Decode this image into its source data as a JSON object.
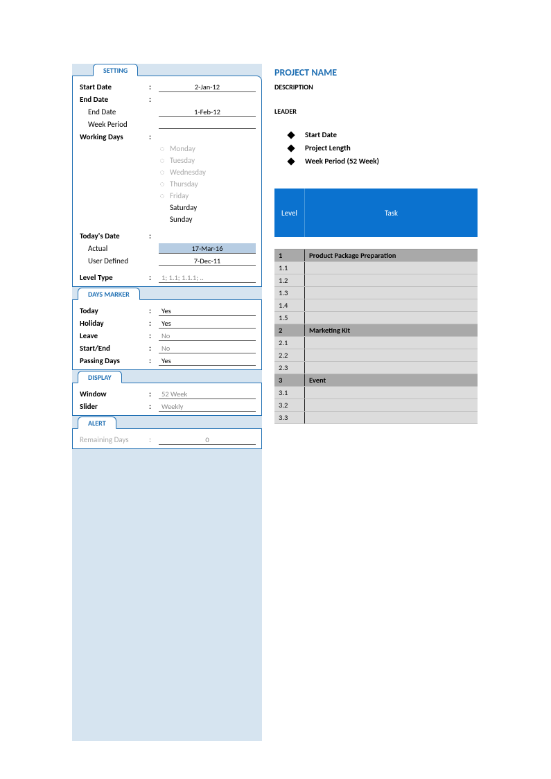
{
  "tabs": {
    "setting": "SETTING",
    "days_marker": "DAYS MARKER",
    "display": "DISPLAY",
    "alert": "ALERT"
  },
  "setting": {
    "start_date": {
      "label": "Start Date",
      "value": "2-Jan-12"
    },
    "end_date_label": "End Date",
    "end_date": {
      "label": "End Date",
      "value": "1-Feb-12"
    },
    "week_period": {
      "label": "Week Period",
      "value": ""
    },
    "working_days_label": "Working Days",
    "working_days": [
      {
        "name": "Monday",
        "active": false
      },
      {
        "name": "Tuesday",
        "active": false
      },
      {
        "name": "Wednesday",
        "active": false
      },
      {
        "name": "Thursday",
        "active": false
      },
      {
        "name": "Friday",
        "active": false
      },
      {
        "name": "Saturday",
        "active": true
      },
      {
        "name": "Sunday",
        "active": true
      }
    ],
    "today_label": "Today's Date",
    "actual": {
      "label": "Actual",
      "value": "17-Mar-16"
    },
    "user_defined": {
      "label": "User Defined",
      "value": "7-Dec-11"
    },
    "level_type": {
      "label": "Level Type",
      "value": "1; 1.1; 1.1.1; .."
    }
  },
  "days_marker": {
    "today": {
      "label": "Today",
      "value": "Yes"
    },
    "holiday": {
      "label": "Holiday",
      "value": "Yes"
    },
    "leave": {
      "label": "Leave",
      "value": "No"
    },
    "start_end": {
      "label": "Start/End",
      "value": "No"
    },
    "passing_days": {
      "label": "Passing Days",
      "value": "Yes"
    }
  },
  "display": {
    "window": {
      "label": "Window",
      "value": "52 Week"
    },
    "slider": {
      "label": "Slider",
      "value": "Weekly"
    }
  },
  "alert": {
    "remaining_days": {
      "label": "Remaining Days",
      "value": "0"
    }
  },
  "project": {
    "name": "PROJECT NAME",
    "description": "DESCRIPTION",
    "leader": "LEADER",
    "bullets": [
      "Start Date",
      "Project Length",
      "Week Period (52 Week)"
    ]
  },
  "table": {
    "headers": {
      "level": "Level",
      "task": "Task"
    },
    "rows": [
      {
        "level": "1",
        "task": "Product Package Preparation",
        "type": "h"
      },
      {
        "level": "1.1",
        "task": "",
        "type": "s"
      },
      {
        "level": "1.2",
        "task": "",
        "type": "s"
      },
      {
        "level": "1.3",
        "task": "",
        "type": "s"
      },
      {
        "level": "1.4",
        "task": "",
        "type": "s"
      },
      {
        "level": "1.5",
        "task": "",
        "type": "s"
      },
      {
        "level": "2",
        "task": "Marketing Kit",
        "type": "h"
      },
      {
        "level": "2.1",
        "task": "",
        "type": "s"
      },
      {
        "level": "2.2",
        "task": "",
        "type": "s"
      },
      {
        "level": "2.3",
        "task": "",
        "type": "s"
      },
      {
        "level": "3",
        "task": "Event",
        "type": "h"
      },
      {
        "level": "3.1",
        "task": "",
        "type": "s"
      },
      {
        "level": "3.2",
        "task": "",
        "type": "s"
      },
      {
        "level": "3.3",
        "task": "",
        "type": "s"
      }
    ]
  }
}
